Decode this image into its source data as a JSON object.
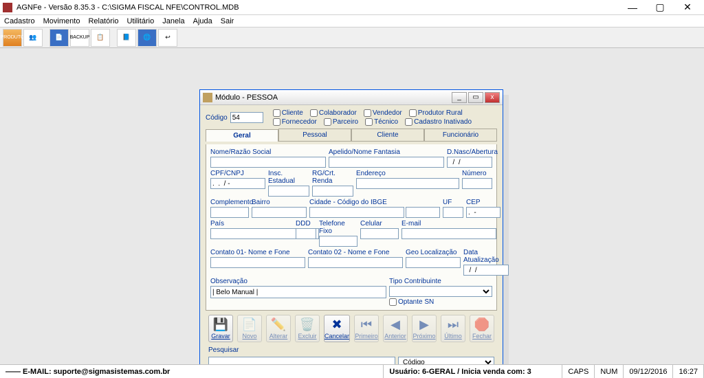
{
  "window": {
    "title": "AGNFe - Versão 8.35.3 - C:\\SIGMA FISCAL NFE\\CONTROL.MDB",
    "min": "—",
    "max": "▢",
    "close": "✕"
  },
  "menu": {
    "items": [
      "Cadastro",
      "Movimento",
      "Relatório",
      "Utilitário",
      "Janela",
      "Ajuda",
      "Sair"
    ]
  },
  "toolbar": {
    "produto": "PRODUTO",
    "backup": "BACKUP"
  },
  "dialog": {
    "title": "Módulo - PESSOA",
    "min": "_",
    "max": "▭",
    "close": "x",
    "codigo_label": "Código",
    "codigo_value": "54",
    "checks": {
      "cliente": "Cliente",
      "fornecedor": "Fornecedor",
      "colaborador": "Colaborador",
      "parceiro": "Parceiro",
      "vendedor": "Vendedor",
      "tecnico": "Técnico",
      "produtor_rural": "Produtor Rural",
      "cad_inativado": "Cadastro Inativado"
    },
    "tabs": {
      "geral": "Geral",
      "pessoal": "Pessoal",
      "cliente": "Cliente",
      "funcionario": "Funcionário"
    },
    "labels": {
      "nome": "Nome/Razão Social",
      "apelido": "Apelido/Nome Fantasia",
      "dnasc": "D.Nasc/Abertura",
      "cpf": "CPF/CNPJ",
      "ie": "Insc. Estadual",
      "rg": "RG/Crt. Renda",
      "end": "Endereço",
      "num": "Número",
      "compl": "Complemento",
      "bairro": "Bairro",
      "cidade": "Cidade - Código do IBGE",
      "uf": "UF",
      "cep": "CEP",
      "pais": "País",
      "ddd": "DDD",
      "tel": "Telefone Fixo",
      "cel": "Celular",
      "email": "E-mail",
      "c1": "Contato 01- Nome e Fone",
      "c2": "Contato 02 - Nome e Fone",
      "geo": "Geo Localização",
      "data_at": "Data Atualização",
      "obs": "Observação",
      "tipo": "Tipo Contribuinte",
      "optante": "Optante SN"
    },
    "values": {
      "dnasc": "  /  /",
      "cpf": ".  .  / -",
      "cep": ".  -",
      "data_at": "  /  /",
      "obs": "| Belo Manual |"
    },
    "buttons": {
      "gravar": "Gravar",
      "novo": "Novo",
      "alterar": "Alterar",
      "excluir": "Excluir",
      "cancelar": "Cancelar",
      "primeiro": "Primeiro",
      "anterior": "Anterior",
      "proximo": "Próximo",
      "ultimo": "Último",
      "fechar": "Fechar"
    },
    "pesquisar": "Pesquisar",
    "search_by": "Código"
  },
  "status": {
    "email": "—— E-MAIL: suporte@sigmasistemas.com.br",
    "usuario": "Usuário: 6-GERAL / Inicia venda com: 3",
    "caps": "CAPS",
    "num": "NUM",
    "date": "09/12/2016",
    "time": "16:27"
  }
}
